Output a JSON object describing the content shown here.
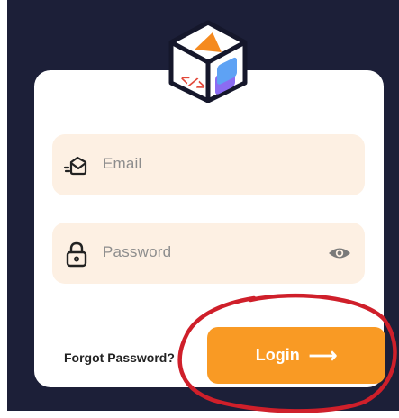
{
  "brand": {
    "logo_icon": "code-cube-logo-icon"
  },
  "form": {
    "email": {
      "placeholder": "Email",
      "icon": "mail-icon"
    },
    "password": {
      "placeholder": "Password",
      "icon": "lock-icon",
      "toggle_icon": "eye-icon"
    },
    "forgot_label": "Forgot Password?",
    "login_label": "Login",
    "login_arrow": "⟶"
  },
  "colors": {
    "background": "#1c1f38",
    "accent": "#f99a24",
    "field_background": "#fdf0e3",
    "annotation": "#cf1f2a"
  }
}
